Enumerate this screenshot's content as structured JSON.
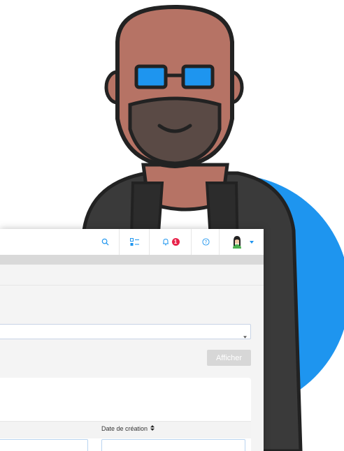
{
  "topbar": {
    "search_icon": "search-icon",
    "checklist_icon": "checklist-icon",
    "notifications_icon": "bell-icon",
    "notifications_count": "1",
    "help_icon": "question-circle-icon",
    "avatar_icon": "avatar-icon",
    "user_menu_icon": "caret-down-icon"
  },
  "filter": {
    "show_button_label": "Afficher"
  },
  "table": {
    "columns": [
      "Date de création"
    ]
  },
  "colors": {
    "accent": "#1e95ef",
    "badge": "#e8234a",
    "button_disabled": "#d7d7d7"
  }
}
